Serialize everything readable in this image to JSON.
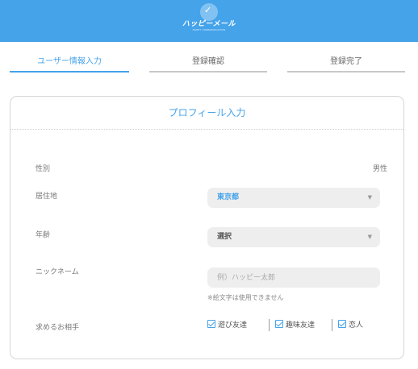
{
  "header": {
    "brand": "ハッピーメール",
    "brand_sub": "HAPPY COMMUNICATION"
  },
  "steps": [
    {
      "label": "ユーザー情報入力",
      "active": true
    },
    {
      "label": "登録確認",
      "active": false
    },
    {
      "label": "登録完了",
      "active": false
    }
  ],
  "form": {
    "title": "プロフィール入力",
    "gender": {
      "label": "性別",
      "value": "男性"
    },
    "residence": {
      "label": "居住地",
      "value": "東京都"
    },
    "age": {
      "label": "年齢",
      "value": "選択"
    },
    "nickname": {
      "label": "ニックネーム",
      "placeholder": "例）ハッピー太郎",
      "note": "※絵文字は使用できません"
    },
    "seeking": {
      "label": "求めるお相手",
      "options": [
        {
          "label": "遊び友達",
          "checked": true
        },
        {
          "label": "趣味友達",
          "checked": true
        },
        {
          "label": "恋人",
          "checked": true
        }
      ]
    }
  },
  "colors": {
    "accent": "#45a3ea",
    "header_bg": "#45a3ea"
  }
}
